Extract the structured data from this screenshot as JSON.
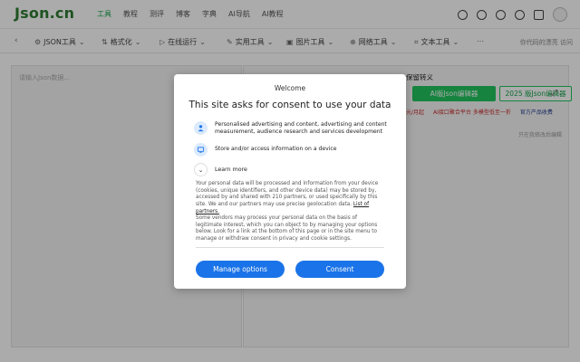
{
  "site": {
    "logo": "Json.cn"
  },
  "topnav": [
    {
      "label": "工具",
      "active": true
    },
    {
      "label": "教程",
      "active": false
    },
    {
      "label": "测评",
      "active": false
    },
    {
      "label": "博客",
      "active": false
    },
    {
      "label": "字典",
      "active": false
    },
    {
      "label": "AI导航",
      "active": false
    },
    {
      "label": "AI教程",
      "active": false
    }
  ],
  "toolbar": {
    "items": [
      "JSON工具",
      "格式化",
      "在线运行",
      "实用工具",
      "图片工具",
      "网络工具",
      "文本工具"
    ],
    "right_text": "你代码的漂亮",
    "right_suffix": "访问"
  },
  "editor": {
    "input_placeholder": "请输入Json数据...",
    "right_title": "保留转义",
    "btn_ai": "AI版Json编辑器",
    "btn_2025": "2025 版Json编辑器",
    "links": [
      {
        "text": "元/月起",
        "color": "red"
      },
      {
        "text": "AI接口聚合平台 多模型低至一折",
        "color": "red"
      },
      {
        "text": "官方产品收费",
        "color": "blue"
      }
    ],
    "hint": "只在我修改后编辑"
  },
  "consent": {
    "welcome": "Welcome",
    "title": "This site asks for consent to use your data",
    "purposes": [
      {
        "icon": "person-icon",
        "text": "Personalised advertising and content, advertising and content measurement, audience research and services development"
      },
      {
        "icon": "device-icon",
        "text": "Store and/or access information on a device"
      }
    ],
    "learn_more": "Learn more",
    "paragraph1": "Your personal data will be processed and information from your device (cookies, unique identifiers, and other device data) may be stored by, accessed by and shared with 210 partners, or used specifically by this site. We and our partners may use precise geolocation data.",
    "partners_link": "List of partners.",
    "paragraph2": "Some vendors may process your personal data on the basis of legitimate interest, which you can object to by managing your options below. Look for a link at the bottom of this page or in the site menu to manage or withdraw consent in privacy and cookie settings.",
    "manage_button": "Manage options",
    "consent_button": "Consent"
  },
  "colors": {
    "brand_green": "#16a34a",
    "consent_blue": "#1a73e8",
    "icon_bg": "#dbeafe"
  }
}
